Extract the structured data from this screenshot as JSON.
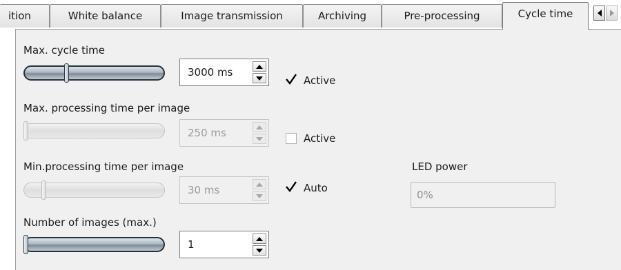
{
  "tabs": [
    {
      "label": "ition",
      "active": false
    },
    {
      "label": "White balance",
      "active": false
    },
    {
      "label": "Image transmission",
      "active": false
    },
    {
      "label": "Archiving",
      "active": false
    },
    {
      "label": "Pre-processing",
      "active": false
    },
    {
      "label": "Cycle time",
      "active": true
    }
  ],
  "scroll_buttons": {
    "left_icon": "arrow-left-icon",
    "right_icon": "arrow-right-icon"
  },
  "cycle": {
    "label": "Max. cycle time",
    "slider_fraction": 0.3,
    "value": "3000 ms",
    "active_label": "Active",
    "active_checked": true
  },
  "processing_max": {
    "label": "Max. processing time per image",
    "slider_fraction": 0.0,
    "value": "250 ms",
    "active_label": "Active",
    "active_checked": false
  },
  "processing_min": {
    "label": "Min.processing time per image",
    "slider_fraction": 0.13,
    "value": "30 ms",
    "auto_label": "Auto",
    "auto_checked": true
  },
  "led": {
    "label": "LED power",
    "value": "0%"
  },
  "images": {
    "label": "Number of images (max.)",
    "slider_fraction": 0.0,
    "value": "1"
  },
  "colors": {
    "panel_bg": "#f0f0f0",
    "slider_dark": "#27313a",
    "disabled_text": "#9a9a9a"
  }
}
